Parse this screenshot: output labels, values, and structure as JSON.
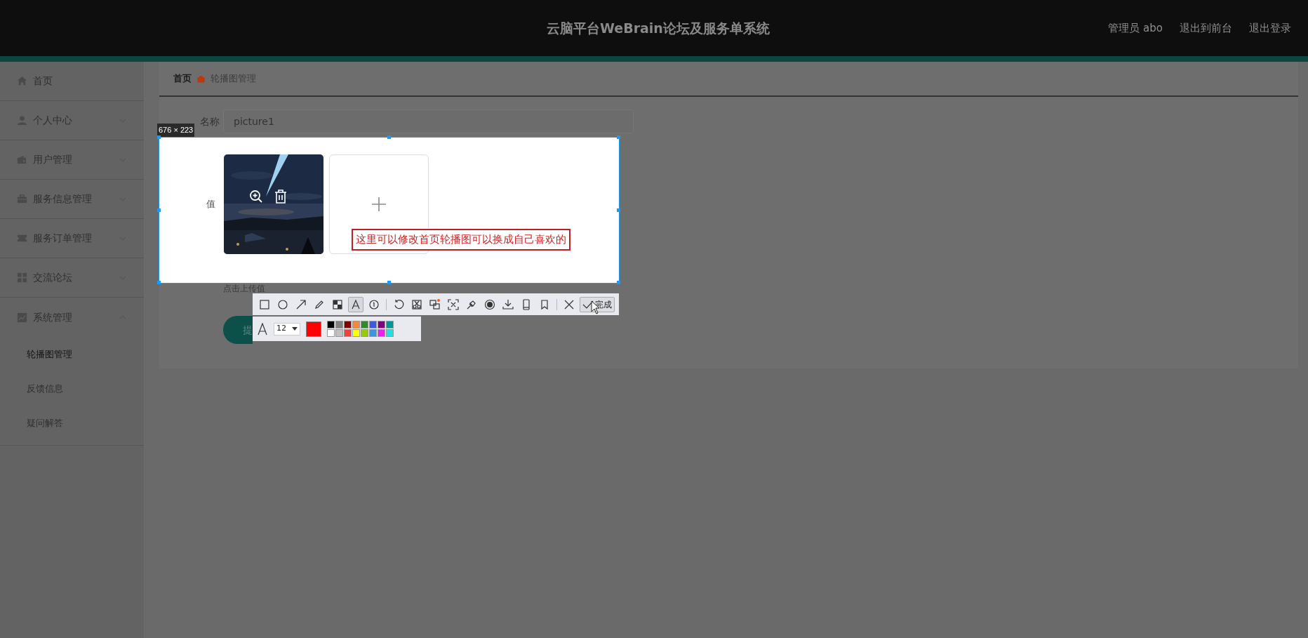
{
  "header": {
    "title": "云脑平台WeBrain论坛及服务单系统",
    "links": [
      "管理员 abo",
      "退出到前台",
      "退出登录"
    ]
  },
  "sidebar": {
    "items": [
      {
        "label": "首页",
        "kind": "link"
      },
      {
        "label": "个人中心",
        "kind": "menu",
        "expanded": false
      },
      {
        "label": "用户管理",
        "kind": "menu",
        "expanded": false
      },
      {
        "label": "服务信息管理",
        "kind": "menu",
        "expanded": false
      },
      {
        "label": "服务订单管理",
        "kind": "menu",
        "expanded": false
      },
      {
        "label": "交流论坛",
        "kind": "menu",
        "expanded": false
      },
      {
        "label": "系统管理",
        "kind": "menu",
        "expanded": true,
        "children": [
          {
            "label": "轮播图管理",
            "selected": true
          },
          {
            "label": "反馈信息",
            "selected": false
          },
          {
            "label": "疑问解答",
            "selected": false
          }
        ]
      }
    ]
  },
  "breadcrumb": [
    "首页",
    "轮播图管理"
  ],
  "form": {
    "name_label": "名称",
    "name_value": "picture1",
    "value_label": "值",
    "upload_hint": "点击上传值",
    "submit_label": "提"
  },
  "screenshot_tool": {
    "size_label": "676 × 223",
    "annotation": "这里可以修改首页轮播图可以换成自己喜欢的",
    "tool_groups": [
      {
        "tools": [
          {
            "kind": "rectangle",
            "selected": false
          },
          {
            "kind": "ellipse",
            "selected": false
          },
          {
            "kind": "arrow",
            "selected": false
          },
          {
            "kind": "pencil",
            "selected": false
          },
          {
            "kind": "mosaic",
            "selected": false
          },
          {
            "kind": "text",
            "selected": true
          },
          {
            "kind": "number",
            "selected": false
          }
        ]
      },
      {
        "tools": [
          {
            "kind": "undo",
            "selected": false
          },
          {
            "kind": "cut",
            "selected": false
          },
          {
            "kind": "translate",
            "selected": false
          },
          {
            "kind": "ocr",
            "selected": false
          },
          {
            "kind": "pin",
            "selected": false
          },
          {
            "kind": "record",
            "selected": false
          },
          {
            "kind": "download",
            "selected": false
          },
          {
            "kind": "phone",
            "selected": false
          },
          {
            "kind": "bookmark",
            "selected": false
          }
        ]
      },
      {
        "tools": [
          {
            "kind": "close",
            "selected": false
          }
        ]
      }
    ],
    "done_label": "完成",
    "font_size": "12",
    "palette": [
      {
        "kind": "current",
        "color": "#ff0000"
      },
      {
        "color": "#000000"
      },
      {
        "color": "#808080"
      },
      {
        "color": "#800000"
      },
      {
        "color": "#f28a3c"
      },
      {
        "color": "#2e8b2e"
      },
      {
        "color": "#3c5adc"
      },
      {
        "color": "#800080"
      },
      {
        "color": "#009494"
      },
      {
        "color": "#ffffff"
      },
      {
        "color": "#c0c0c0"
      },
      {
        "color": "#f04040"
      },
      {
        "color": "#ffff00"
      },
      {
        "color": "#99cc00"
      },
      {
        "color": "#3b96e0"
      },
      {
        "color": "#f01ef0"
      },
      {
        "color": "#1ee0e0"
      }
    ]
  }
}
